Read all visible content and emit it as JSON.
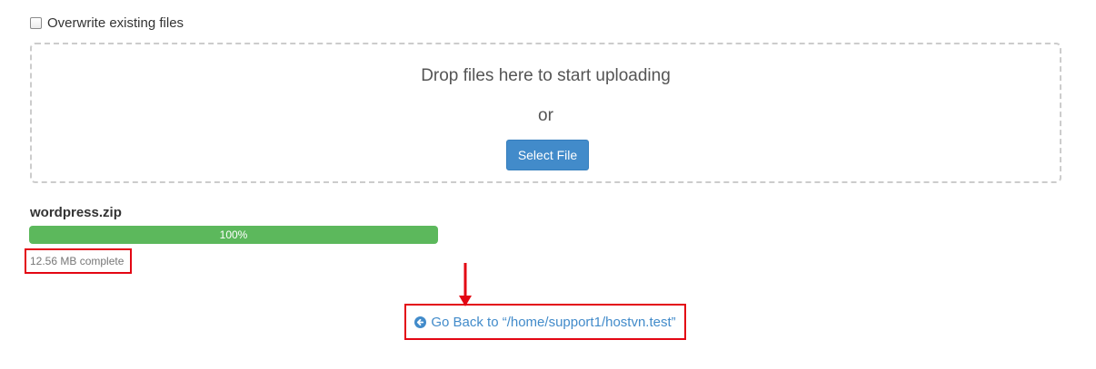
{
  "options": {
    "overwrite_label": "Overwrite existing files",
    "overwrite_checked": false
  },
  "dropzone": {
    "drop_text": "Drop files here to start uploading",
    "or_text": "or",
    "select_button_label": "Select File"
  },
  "upload": {
    "file_name": "wordpress.zip",
    "progress_label": "100%",
    "progress_fraction": 1.0,
    "status_text": "12.56 MB complete"
  },
  "navigation": {
    "go_back_label": "Go Back to “/home/support1/hostvn.test”",
    "icon": "circle-arrow-left-icon"
  },
  "colors": {
    "primary": "#428bca",
    "progress": "#5cb85c",
    "annotation": "#e30613"
  }
}
